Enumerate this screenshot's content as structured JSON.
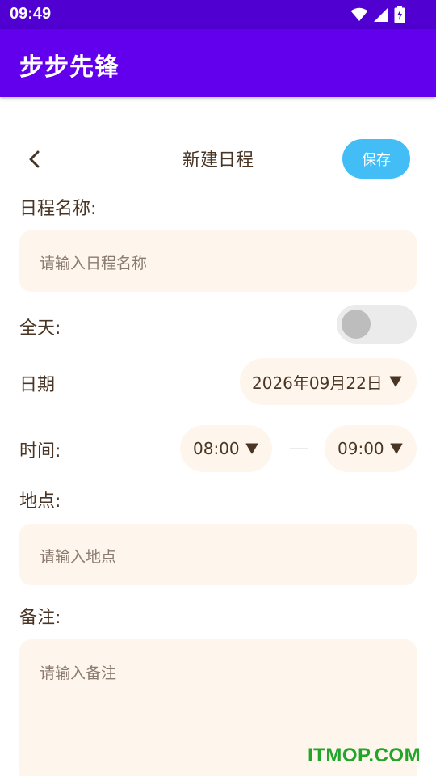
{
  "status_bar": {
    "time": "09:49"
  },
  "app_bar": {
    "title": "步步先锋"
  },
  "header": {
    "title": "新建日程",
    "save_label": "保存"
  },
  "form": {
    "name_label": "日程名称:",
    "name_placeholder": "请输入日程名称",
    "all_day_label": "全天:",
    "all_day_on": false,
    "date_label": "日期",
    "date_value": "2026年09月22日",
    "time_label": "时间:",
    "start_time": "08:00",
    "end_time": "09:00",
    "location_label": "地点:",
    "location_placeholder": "请输入地点",
    "notes_label": "备注:",
    "notes_placeholder": "请输入备注"
  },
  "watermark": "ITMOP.COM",
  "colors": {
    "status_bar": "#5000d0",
    "app_bar": "#6200ee",
    "save_button": "#42bdf5",
    "field_background": "#fef6ec",
    "text": "#4a3524",
    "watermark": "#22a52a"
  },
  "icons": [
    "wifi-icon",
    "signal-icon",
    "battery-charging-icon",
    "back-arrow-icon",
    "dropdown-arrow-icon"
  ]
}
